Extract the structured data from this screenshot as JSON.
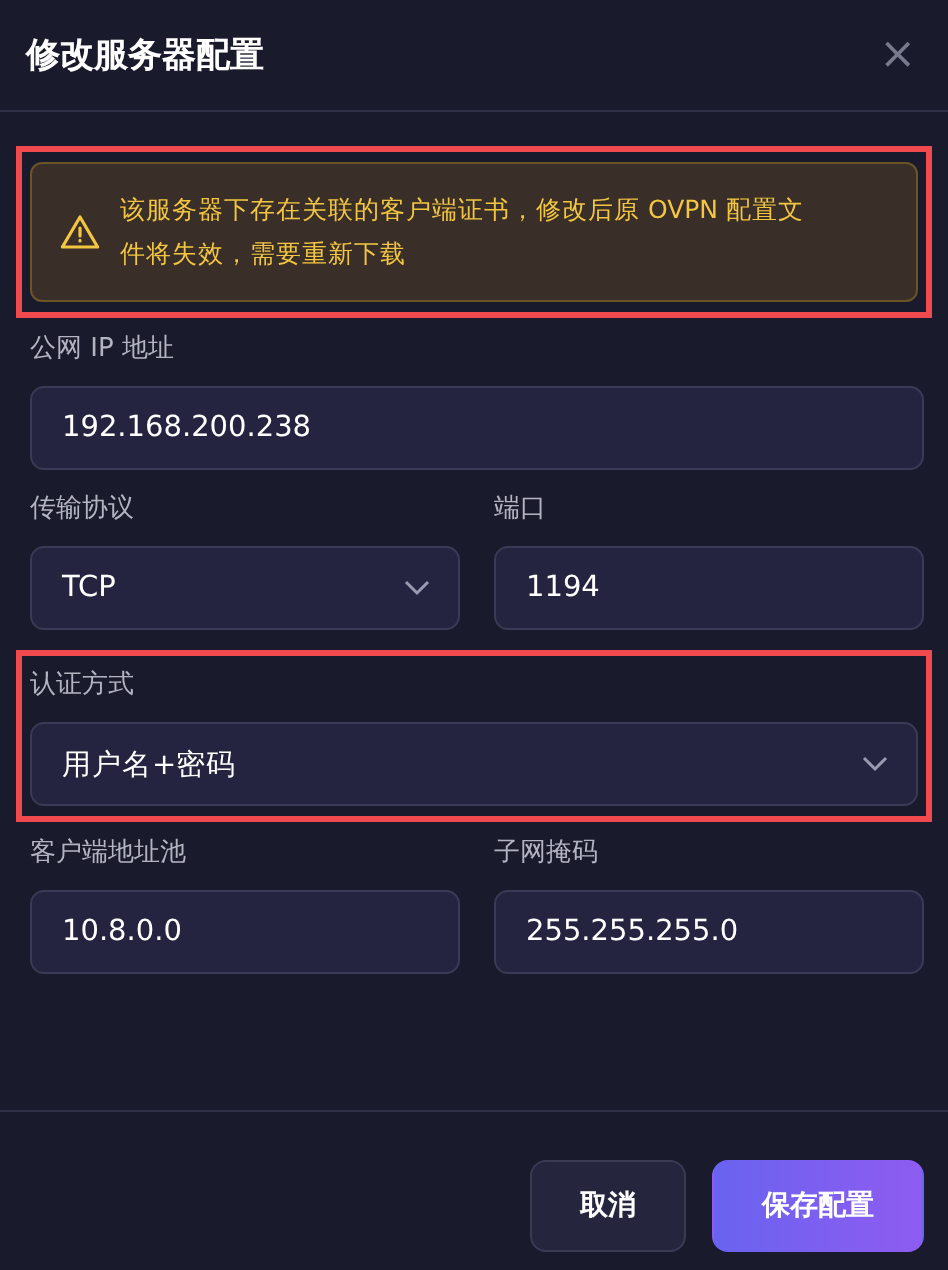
{
  "dialog": {
    "title": "修改服务器配置",
    "close": "×"
  },
  "warning": {
    "text": "该服务器下存在关联的客户端证书，修改后原 OVPN 配置文件将失效，需要重新下载",
    "highlighted": true
  },
  "rows": [
    {
      "highlighted": false,
      "fields": [
        {
          "label": "公网 IP 地址",
          "kind": "input",
          "value": "192.168.200.238"
        }
      ]
    },
    {
      "highlighted": false,
      "fields": [
        {
          "label": "传输协议",
          "kind": "select",
          "value": "TCP"
        },
        {
          "label": "端口",
          "kind": "input",
          "value": "1194"
        }
      ]
    },
    {
      "highlighted": true,
      "fields": [
        {
          "label": "认证方式",
          "kind": "select",
          "value": "用户名+密码"
        }
      ]
    },
    {
      "highlighted": false,
      "fields": [
        {
          "label": "客户端地址池",
          "kind": "input",
          "value": "10.8.0.0"
        },
        {
          "label": "子网掩码",
          "kind": "input",
          "value": "255.255.255.0"
        }
      ]
    }
  ],
  "buttons": [
    {
      "label": "取消",
      "kind": "secondary"
    },
    {
      "label": "保存配置",
      "kind": "primary"
    }
  ]
}
